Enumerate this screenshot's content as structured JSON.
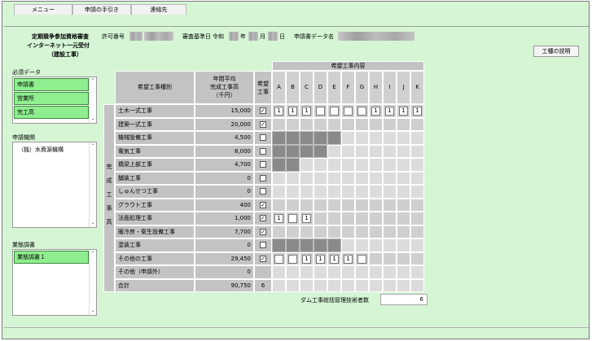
{
  "menu": [
    "メニュー",
    "申請の手引き",
    "連絡先"
  ],
  "header": {
    "title_line1": "定期競争参加資格審査",
    "title_line2": "インターネット一元受付",
    "title_line3": "（建設工事）",
    "permit_label": "許可番号",
    "review_label": "審査基準日",
    "era": "令和",
    "year_suffix": "年",
    "month_suffix": "月",
    "day_suffix": "日",
    "data_name_label": "申請書データ名"
  },
  "buttons": {
    "explain": "工種の説明"
  },
  "sidebar": {
    "required_title": "必須データ",
    "required_items": [
      "申請書",
      "営業所",
      "完工高"
    ],
    "agency_title": "申請機関",
    "agency_items": [
      "（独）水資源機構"
    ],
    "survey_title": "業態調書",
    "survey_items": [
      "業態調書１"
    ]
  },
  "table": {
    "h_type": "希望工事種別",
    "h_avg": [
      "年間平均",
      "完成工事高",
      "（千円）"
    ],
    "h_want": [
      "希望",
      "工事"
    ],
    "h_content": "希望工事内容",
    "letters": [
      "A",
      "B",
      "C",
      "D",
      "E",
      "F",
      "G",
      "H",
      "I",
      "J",
      "K"
    ],
    "side_label": [
      "完",
      "成",
      "工",
      "事",
      "高"
    ],
    "rows": [
      {
        "name": "土木一式工事",
        "amount": "15,000",
        "check": true,
        "cells": [
          "1",
          "1",
          "1",
          "",
          "",
          "",
          "",
          "1",
          "1",
          "1",
          "1"
        ],
        "dark": []
      },
      {
        "name": "建築一式工事",
        "amount": "20,000",
        "check": true,
        "cells": [],
        "dark": []
      },
      {
        "name": "機械設備工事",
        "amount": "4,500",
        "check": false,
        "cells": [],
        "dark": [
          0,
          1,
          2,
          3,
          4
        ]
      },
      {
        "name": "電気工事",
        "amount": "8,000",
        "check": false,
        "cells": [],
        "dark": [
          0,
          1,
          2,
          3
        ]
      },
      {
        "name": "橋梁上部工事",
        "amount": "4,700",
        "check": false,
        "cells": [],
        "dark": [
          0,
          1
        ]
      },
      {
        "name": "舗装工事",
        "amount": "0",
        "check": false,
        "cells": [],
        "dark": []
      },
      {
        "name": "しゅんせつ工事",
        "amount": "0",
        "check": false,
        "cells": [],
        "dark": []
      },
      {
        "name": "グラウト工事",
        "amount": "400",
        "check": true,
        "cells": [],
        "dark": []
      },
      {
        "name": "法面処理工事",
        "amount": "1,000",
        "check": true,
        "cells": [
          "1",
          "",
          "1"
        ],
        "dark": []
      },
      {
        "name": "暖冷房・衛生設備工事",
        "amount": "7,700",
        "check": true,
        "cells": [],
        "dark": []
      },
      {
        "name": "塗装工事",
        "amount": "0",
        "check": false,
        "cells": [],
        "dark": [
          0,
          1,
          2,
          3,
          4
        ]
      },
      {
        "name": "その他の工事",
        "amount": "29,450",
        "check": true,
        "cells": [
          "",
          "",
          "1",
          "1",
          "1",
          "1",
          ""
        ],
        "dark": []
      },
      {
        "name": "その他（申請外）",
        "amount": "0",
        "check": null,
        "cells": [],
        "dark": []
      },
      {
        "name": "合計",
        "amount": "90,750",
        "check": null,
        "total": "6",
        "cells": [],
        "dark": []
      }
    ]
  },
  "dam": {
    "label": "ダム工事総括管理技術者数",
    "value": "6"
  }
}
